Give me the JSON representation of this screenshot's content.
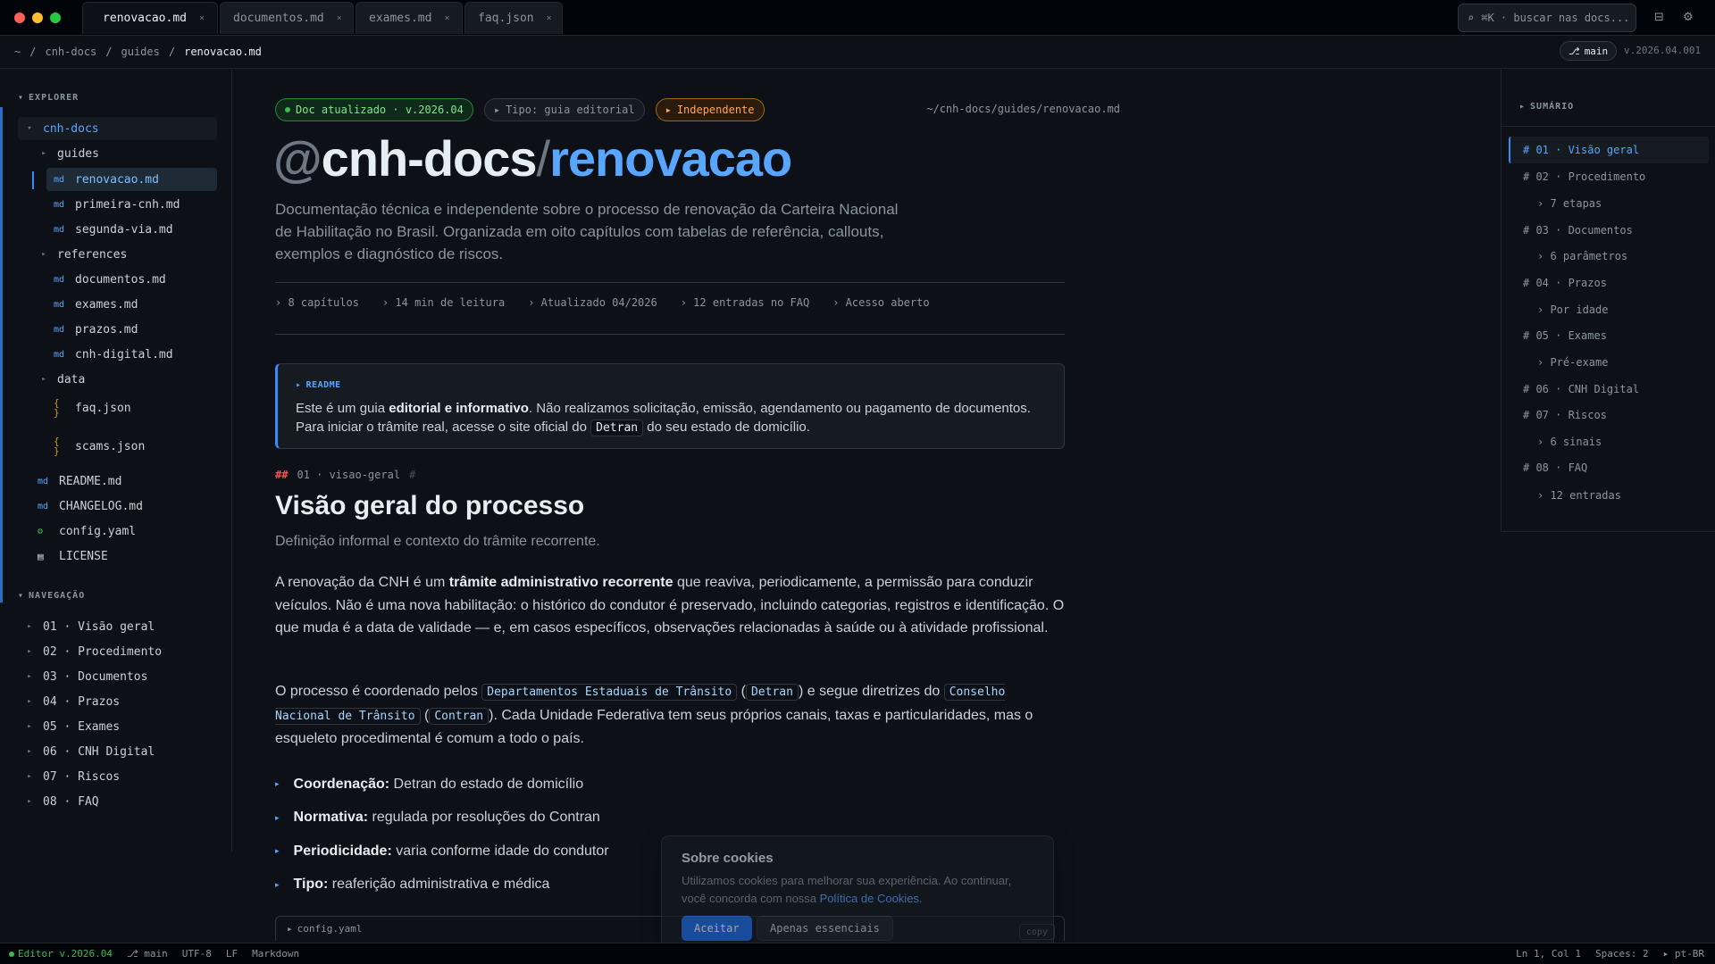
{
  "window": {
    "tabs": [
      {
        "label": "renovacao.md",
        "active": true
      },
      {
        "label": "documentos.md"
      },
      {
        "label": "exames.md"
      },
      {
        "label": "faq.json"
      }
    ],
    "tab_close": "×",
    "search_placeholder": "⌘K · buscar nas docs...",
    "search_icon": "⌕"
  },
  "breadcrumb": {
    "items": [
      "~",
      "cnh-docs",
      "guides",
      "renovacao.md"
    ],
    "sep": "/",
    "branch": "main",
    "branch_icon": "⎇",
    "version": "v.2026.04.001"
  },
  "sidebar": {
    "explorer_label": "EXPLORER",
    "tree": [
      {
        "label": "cnh-docs",
        "kind": "folder-open"
      },
      {
        "label": "guides",
        "kind": "folder"
      },
      {
        "label": "renovacao.md",
        "kind": "md",
        "selected": true
      },
      {
        "label": "primeira-cnh.md",
        "kind": "md"
      },
      {
        "label": "segunda-via.md",
        "kind": "md"
      },
      {
        "label": "references",
        "kind": "folder"
      },
      {
        "label": "documentos.md",
        "kind": "md"
      },
      {
        "label": "exames.md",
        "kind": "md"
      },
      {
        "label": "prazos.md",
        "kind": "md"
      },
      {
        "label": "cnh-digital.md",
        "kind": "md"
      },
      {
        "label": "data",
        "kind": "folder"
      },
      {
        "label": "faq.json",
        "kind": "json"
      },
      {
        "label": "scams.json",
        "kind": "json"
      },
      {
        "label": "README.md",
        "kind": "md"
      },
      {
        "label": "CHANGELOG.md",
        "kind": "md"
      },
      {
        "label": "config.yaml",
        "kind": "yaml"
      },
      {
        "label": "LICENSE",
        "kind": "file"
      }
    ],
    "md_tag": "md",
    "nav_label": "NAVEGAÇÃO",
    "nav": [
      "01 · Visão geral",
      "02 · Procedimento",
      "03 · Documentos",
      "04 · Prazos",
      "05 · Exames",
      "06 · CNH Digital",
      "07 · Riscos",
      "08 · FAQ"
    ]
  },
  "main": {
    "badges": [
      "Doc atualizado · v.2026.04",
      "Tipo: guia editorial",
      "Independente"
    ],
    "path": "~/cnh-docs/guides/renovacao.md",
    "hero": {
      "at": "@",
      "pkg": "cnh-docs",
      "slash": "/",
      "name": "renovacao"
    },
    "lead": "Documentação técnica e independente sobre o processo de renovação da Carteira Nacional de Habilitação no Brasil. Organizada em oito capítulos com tabelas de referência, callouts, exemplos e diagnóstico de riscos.",
    "meta": [
      "8 capítulos",
      "14 min de leitura",
      "Atualizado 04/2026",
      "12 entradas no FAQ",
      "Acesso aberto"
    ],
    "callout": {
      "label": "README",
      "t1": "Este é um guia ",
      "b1": "editorial e informativo",
      "t2": ". Não realizamos solicitação, emissão, agendamento ou pagamento de documentos. Para iniciar o trâmite real, acesse o site oficial do ",
      "code": "Detran",
      "t3": " do seu estado de domicílio."
    },
    "section": {
      "hash": "##",
      "anchor": "01 · visao-geral",
      "hash2": "#",
      "title": "Visão geral do processo",
      "subtitle": "Definição informal e contexto do trâmite recorrente."
    },
    "p1": {
      "t1": "A renovação da CNH é um ",
      "b1": "trâmite administrativo recorrente",
      "t2": " que reaviva, periodicamente, a permissão para conduzir veículos. Não é uma nova habilitação: o histórico do condutor é preservado, incluindo categorias, registros e identificação. O que muda é a data de validade — e, em casos específicos, observações relacionadas à saúde ou à atividade profissional."
    },
    "p2": {
      "t1": "O processo é coordenado pelos ",
      "c1": "Departamentos Estaduais de Trânsito",
      "t2": " (",
      "c2": "Detran",
      "t3": ") e segue diretrizes do ",
      "c3": "Conselho Nacional de Trânsito",
      "t4": " (",
      "c4": "Contran",
      "t5": "). Cada Unidade Federativa tem seus próprios canais, taxas e particularidades, mas o esqueleto procedimental é comum a todo o país."
    },
    "bullets": [
      {
        "b": "Coordenação:",
        "t": " Detran do estado de domicílio"
      },
      {
        "b": "Normativa:",
        "t": " regulada por resoluções do Contran"
      },
      {
        "b": "Periodicidade:",
        "t": " varia conforme idade do condutor"
      },
      {
        "b": "Tipo:",
        "t": " reaferição administrativa e médica"
      }
    ],
    "codeblock": {
      "file": "config.yaml",
      "copy": "copy"
    }
  },
  "toc": {
    "label": "SUMÁRIO",
    "items": [
      {
        "label": "# 01 · Visão geral",
        "level": 1,
        "active": true
      },
      {
        "label": "# 02 · Procedimento",
        "level": 1
      },
      {
        "label": "› 7 etapas",
        "level": 2
      },
      {
        "label": "# 03 · Documentos",
        "level": 1
      },
      {
        "label": "› 6 parâmetros",
        "level": 2
      },
      {
        "label": "# 04 · Prazos",
        "level": 1
      },
      {
        "label": "› Por idade",
        "level": 2
      },
      {
        "label": "# 05 · Exames",
        "level": 1
      },
      {
        "label": "› Pré-exame",
        "level": 2
      },
      {
        "label": "# 06 · CNH Digital",
        "level": 1
      },
      {
        "label": "# 07 · Riscos",
        "level": 1
      },
      {
        "label": "› 6 sinais",
        "level": 2
      },
      {
        "label": "# 08 · FAQ",
        "level": 1
      },
      {
        "label": "› 12 entradas",
        "level": 2
      }
    ]
  },
  "cookie": {
    "title": "Sobre cookies",
    "text": "Utilizamos cookies para melhorar sua experiência. Ao continuar, você concorda com nossa ",
    "link": "Política de Cookies",
    "dot": ".",
    "accept": "Aceitar",
    "essential": "Apenas essenciais"
  },
  "statusbar": {
    "left": [
      "Editor v.2026.04",
      "main",
      "UTF-8",
      "LF",
      "Markdown"
    ],
    "branch_icon": "⎇",
    "right": [
      "Ln 1, Col 1",
      "Spaces: 2",
      "pt-BR"
    ]
  },
  "colors": {
    "accent": "#58a6ff",
    "bg": "#0d1117",
    "green": "#3fb950",
    "orange": "#ffa657",
    "red": "#f85149"
  }
}
